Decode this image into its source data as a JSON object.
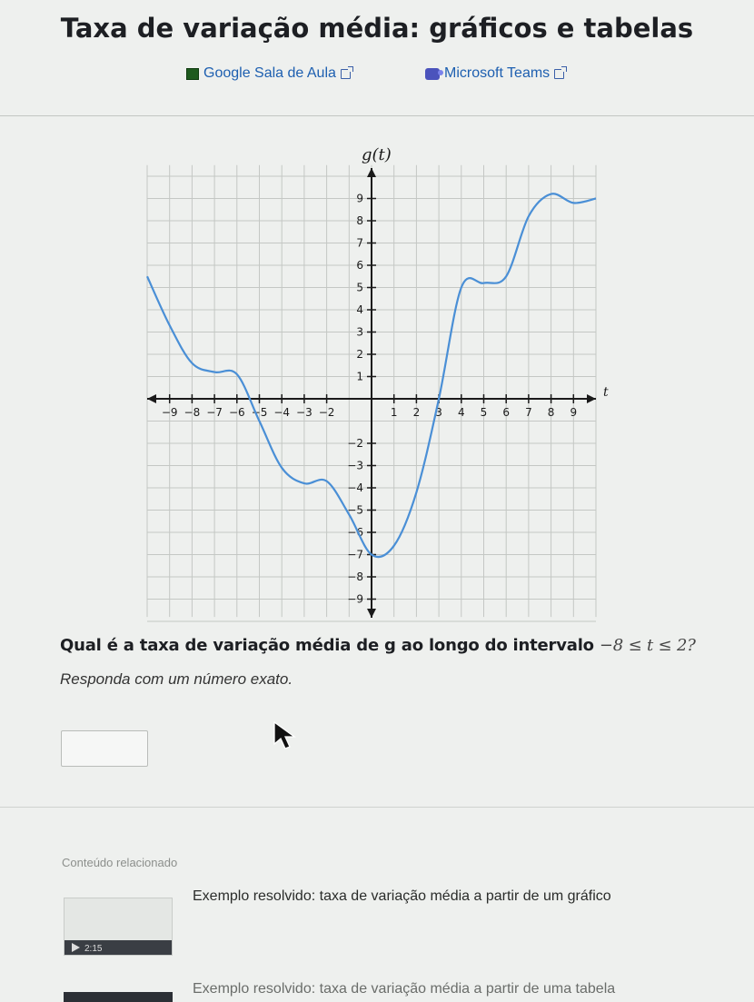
{
  "page": {
    "title": "Taxa de variação média: gráficos e tabelas",
    "share": {
      "classroom_label": "Google Sala de Aula",
      "teams_label": "Microsoft Teams"
    }
  },
  "graph": {
    "function_label": "g(t)",
    "t_label": "t",
    "x_ticks": [
      "−9",
      "−8",
      "−7",
      "−6",
      "−5",
      "−4",
      "−3",
      "−2",
      "1",
      "2",
      "3",
      "4",
      "5",
      "6",
      "7",
      "8",
      "9"
    ],
    "y_ticks": [
      "9",
      "8",
      "7",
      "6",
      "5",
      "4",
      "3",
      "2",
      "1",
      "−2",
      "−3",
      "−4",
      "−5",
      "−6",
      "−7",
      "−8",
      "−9"
    ],
    "curve_color": "#4a8fd6",
    "curve_points": [
      [
        -10,
        5.5
      ],
      [
        -9,
        3.3
      ],
      [
        -8,
        1.6
      ],
      [
        -7,
        1.2
      ],
      [
        -6,
        1.1
      ],
      [
        -5,
        -1
      ],
      [
        -4,
        -3.1
      ],
      [
        -3,
        -3.8
      ],
      [
        -2,
        -3.7
      ],
      [
        -1,
        -5.2
      ],
      [
        0,
        -7
      ],
      [
        1,
        -6.6
      ],
      [
        2,
        -4.2
      ],
      [
        3,
        0
      ],
      [
        4,
        5
      ],
      [
        5,
        5.2
      ],
      [
        6,
        5.5
      ],
      [
        7,
        8.2
      ],
      [
        8,
        9.2
      ],
      [
        9,
        8.8
      ],
      [
        10,
        9
      ]
    ]
  },
  "question": {
    "text": "Qual é a taxa de variação média de g ao longo do intervalo",
    "interval": "−8 ≤ t ≤ 2?",
    "instruction": "Responda com um número exato.",
    "answer_value": ""
  },
  "related": {
    "heading": "Conteúdo relacionado",
    "items": [
      {
        "title": "Exemplo resolvido: taxa de variação média a partir de um gráfico",
        "duration": "2:15"
      },
      {
        "title": "Exemplo resolvido: taxa de variação média a partir de uma tabela"
      }
    ]
  }
}
